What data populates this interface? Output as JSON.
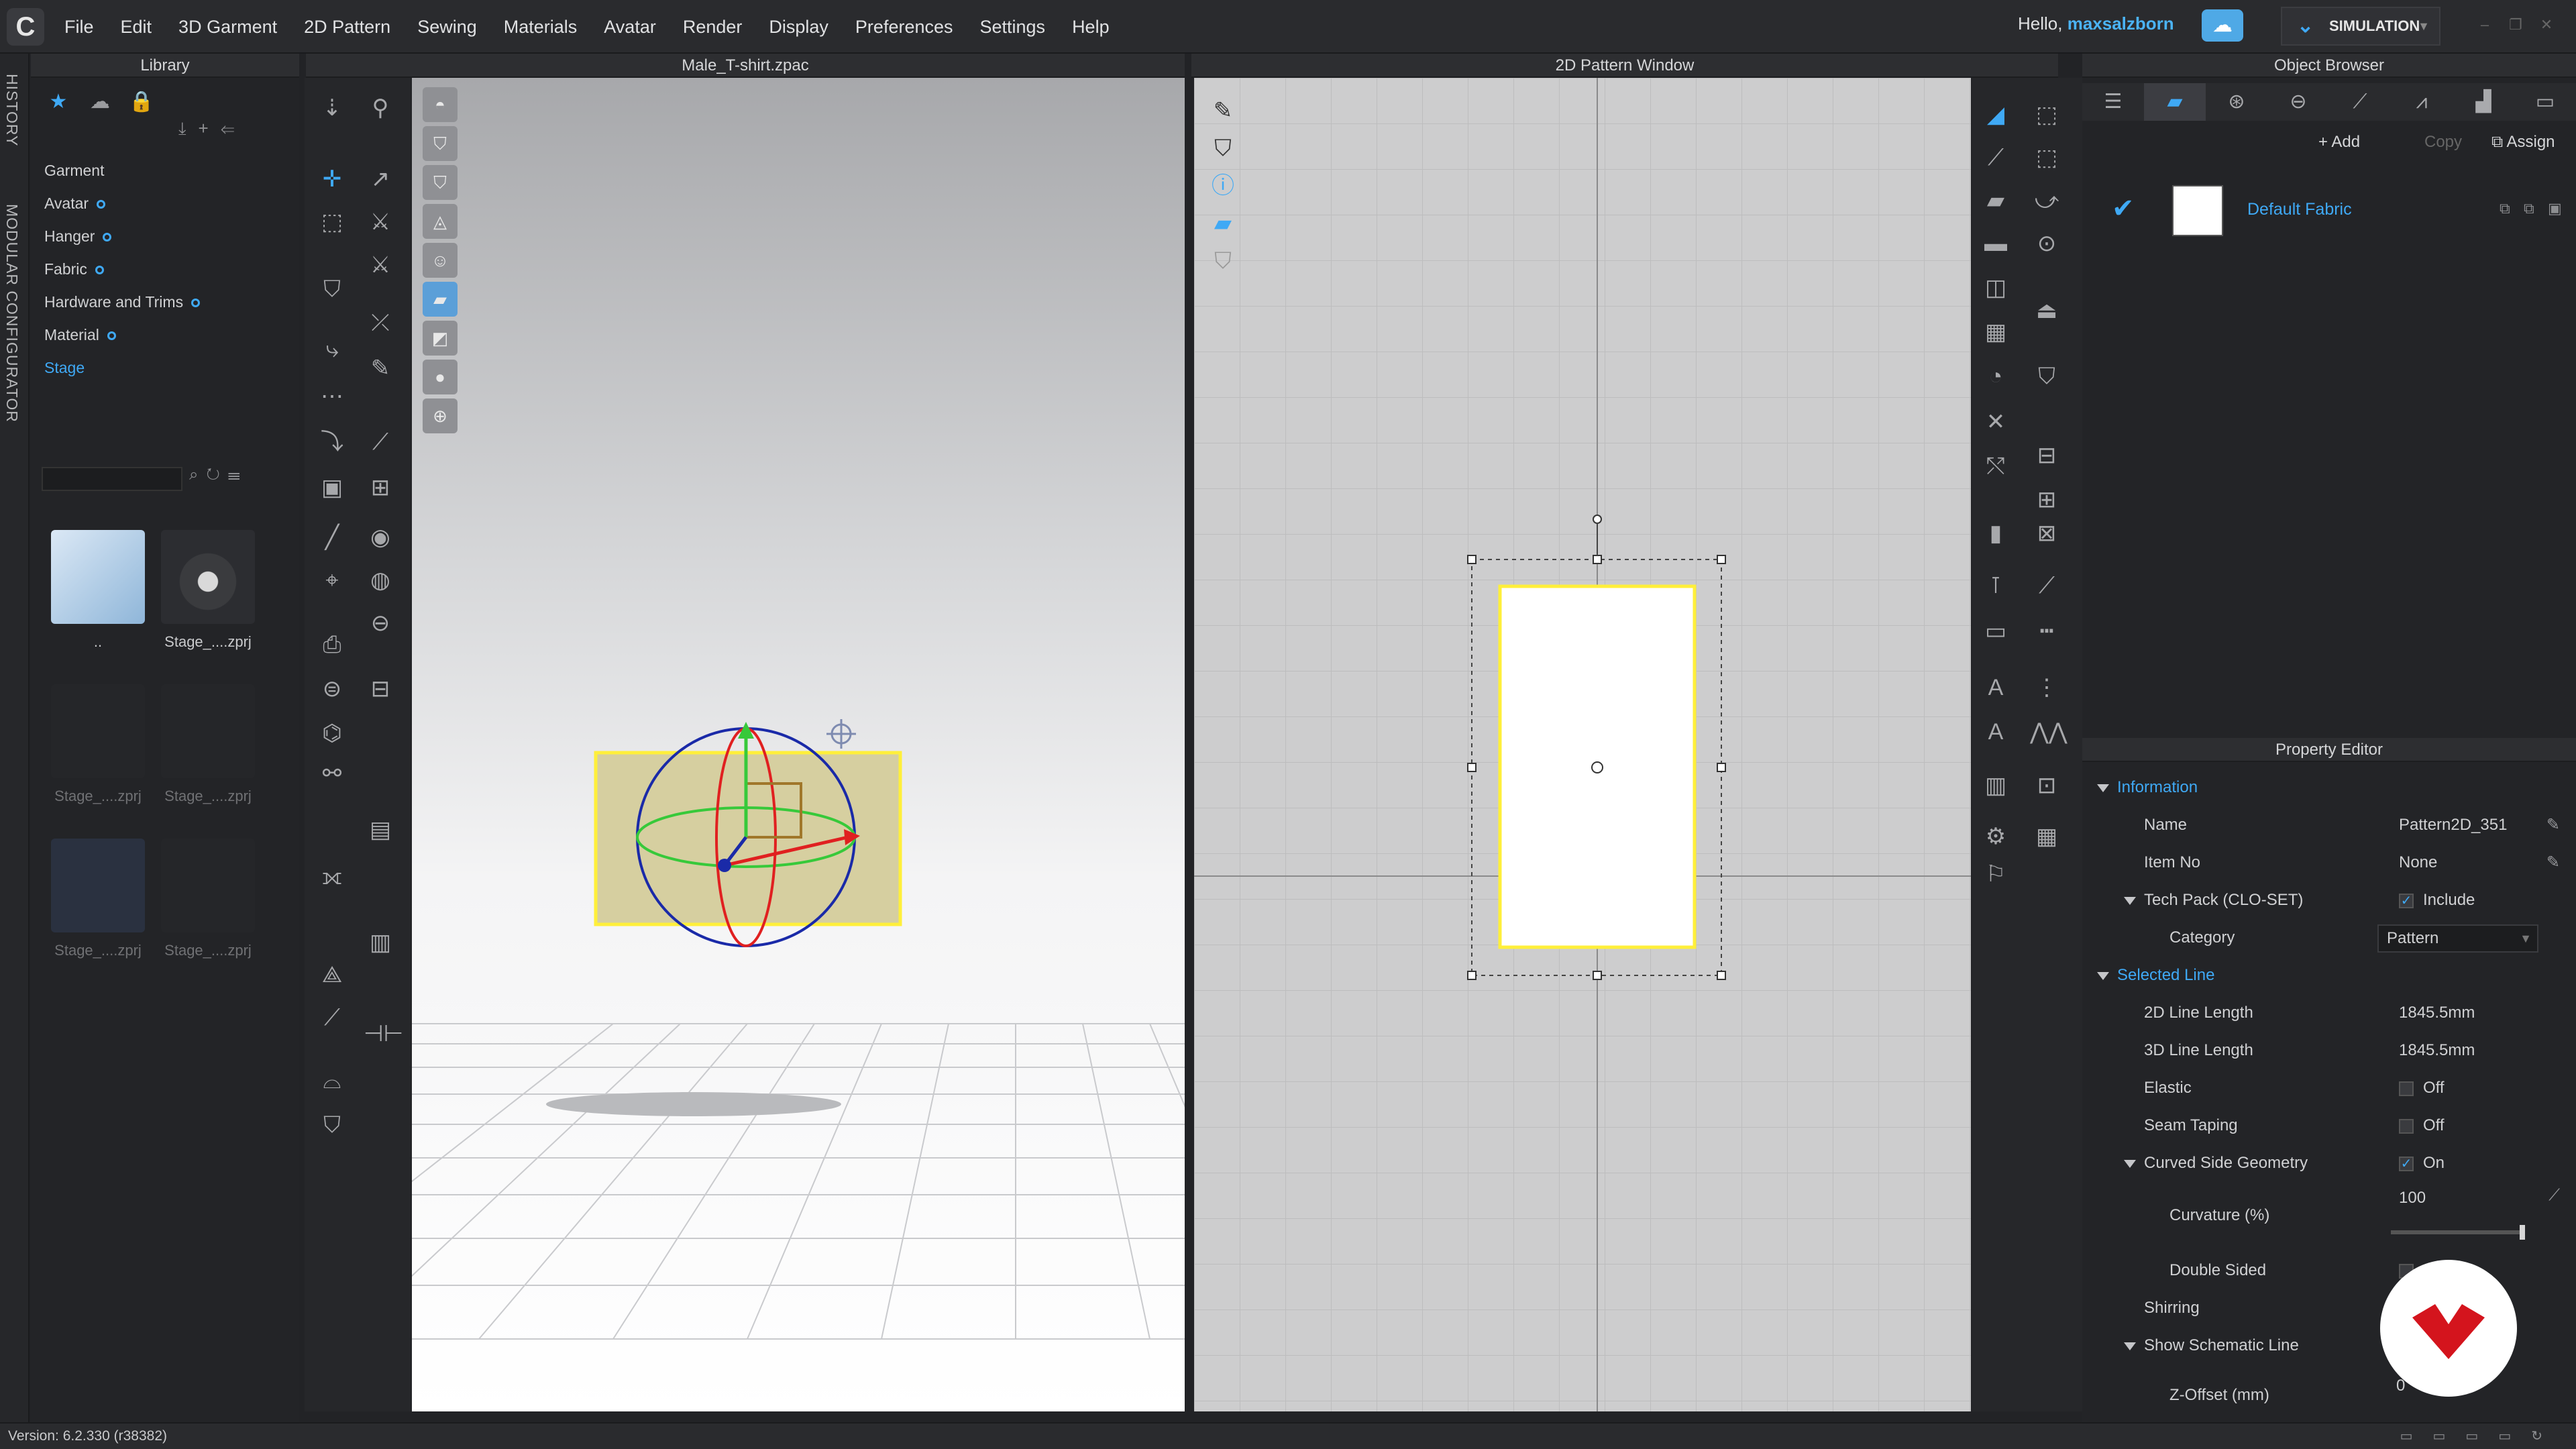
{
  "app": {
    "menu": [
      "File",
      "Edit",
      "3D Garment",
      "2D Pattern",
      "Sewing",
      "Materials",
      "Avatar",
      "Render",
      "Display",
      "Preferences",
      "Settings",
      "Help"
    ],
    "greeting": "Hello,",
    "username": "maxsalzborn",
    "mode_button": "SIMULATION",
    "logo_glyph": "C"
  },
  "side_tabs": [
    "HISTORY",
    "MODULAR CONFIGURATOR"
  ],
  "library": {
    "title": "Library",
    "tree": [
      "Garment",
      "Avatar",
      "Hanger",
      "Fabric",
      "Hardware and Trims",
      "Material",
      "Stage"
    ],
    "thumbnails": [
      "..",
      "Stage_....zprj",
      "Stage_....zprj",
      "Stage_....zprj",
      "Stage_....zprj",
      "Stage_....zprj"
    ]
  },
  "viewport3d": {
    "title": "Male_T-shirt.zpac"
  },
  "pattern2d": {
    "title": "2D Pattern Window"
  },
  "object_browser": {
    "title": "Object Browser",
    "add": "+ Add",
    "copy": "Copy",
    "assign": "Assign",
    "fabric_name": "Default Fabric",
    "fabric_color": "#ffffff"
  },
  "property_editor": {
    "title": "Property Editor",
    "information": "Information",
    "name_label": "Name",
    "name_value": "Pattern2D_351",
    "itemno_label": "Item No",
    "itemno_value": "None",
    "techpack_label": "Tech Pack (CLO-SET)",
    "techpack_value": "Include",
    "category_label": "Category",
    "category_value": "Pattern",
    "selected_line": "Selected Line",
    "len2d_label": "2D Line Length",
    "len2d_value": "1845.5mm",
    "len3d_label": "3D Line Length",
    "len3d_value": "1845.5mm",
    "elastic_label": "Elastic",
    "elastic_value": "Off",
    "seamtape_label": "Seam Taping",
    "seamtape_value": "Off",
    "curved_label": "Curved Side Geometry",
    "curved_value": "On",
    "curvature_label": "Curvature (%)",
    "curvature_value": "100",
    "double_label": "Double Sided",
    "shirring_label": "Shirring",
    "schematic_label": "Show Schematic Line",
    "zoffset_label": "Z-Offset (mm)",
    "zoffset_value": "0"
  },
  "status": {
    "version": "Version: 6.2.330 (r38382)"
  },
  "colors": {
    "accent": "#3fa9f5",
    "selection": "#ffef3a",
    "badge_red": "#d4141d"
  }
}
